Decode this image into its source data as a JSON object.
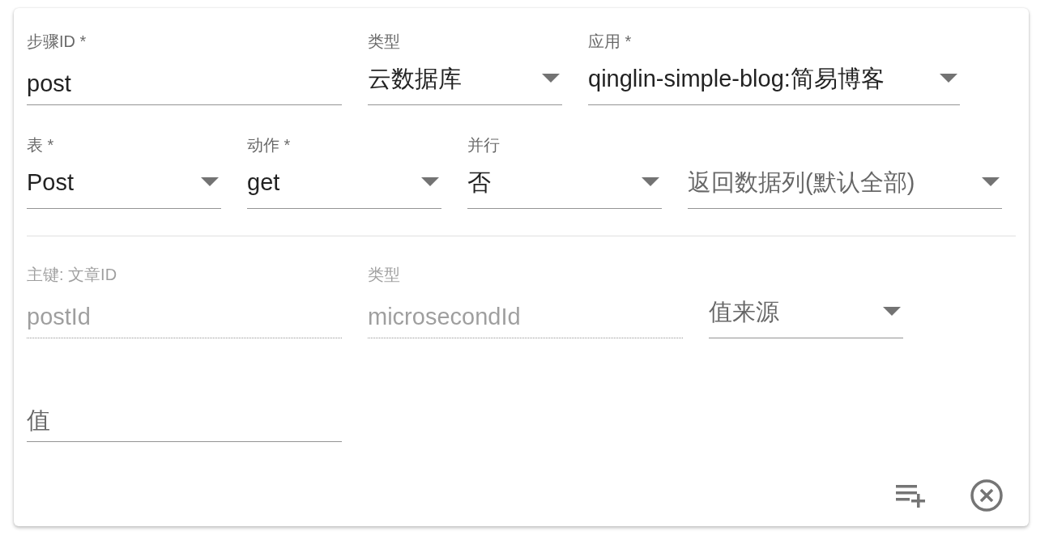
{
  "sections": [
    {
      "rows": [
        {
          "fields": [
            {
              "kind": "text",
              "label": "步骤ID *",
              "value": "post",
              "disabled": false
            },
            {
              "kind": "select",
              "label": "类型",
              "value": "云数据库",
              "disabled": false
            },
            {
              "kind": "select",
              "label": "应用 *",
              "value": "qinglin-simple-blog:简易博客",
              "disabled": false
            }
          ]
        },
        {
          "fields": [
            {
              "kind": "select",
              "label": "表 *",
              "value": "Post",
              "disabled": false
            },
            {
              "kind": "select",
              "label": "动作 *",
              "value": "get",
              "disabled": false
            },
            {
              "kind": "select",
              "label": "并行",
              "value": "否",
              "disabled": false
            },
            {
              "kind": "select",
              "placeholder": "返回数据列(默认全部)",
              "disabled": false
            }
          ]
        }
      ]
    },
    {
      "rows": [
        {
          "fields": [
            {
              "kind": "text",
              "label": "主键: 文章ID",
              "value": "postId",
              "disabled": true
            },
            {
              "kind": "text",
              "label": "类型",
              "value": "microsecondId",
              "disabled": true
            },
            {
              "kind": "select",
              "placeholder": "值来源",
              "disabled": false
            }
          ]
        },
        {
          "fields": [
            {
              "kind": "text",
              "placeholder": "值",
              "disabled": false
            }
          ]
        }
      ]
    }
  ],
  "actions": [
    {
      "kind": "add-row"
    },
    {
      "kind": "remove"
    }
  ]
}
